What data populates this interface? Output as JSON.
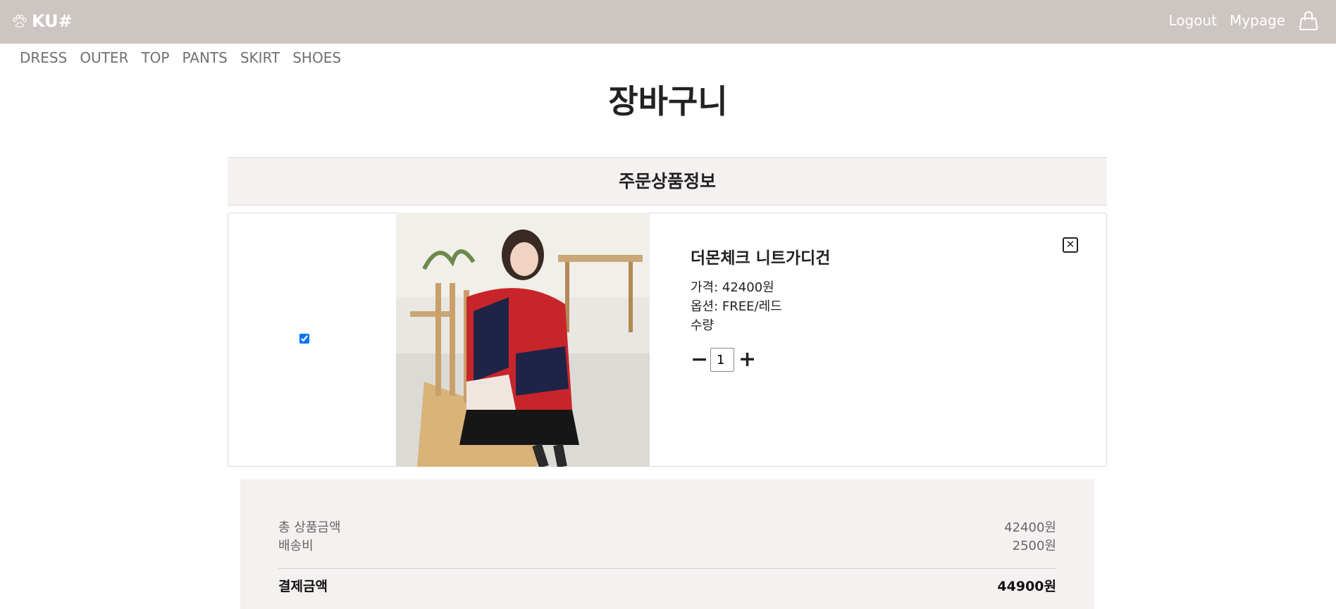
{
  "header": {
    "logo_text": "KU#",
    "logout": "Logout",
    "mypage": "Mypage",
    "background_color": "#cdc5c2"
  },
  "nav": [
    "DRESS",
    "OUTER",
    "TOP",
    "PANTS",
    "SKIRT",
    "SHOES"
  ],
  "page_title": "장바구니",
  "section_title": "주문상품정보",
  "cart_item": {
    "checked": true,
    "name": "더몬체크 니트가디건",
    "price_line": "가격: 42400원",
    "option_line": "옵션: FREE/레드",
    "quantity_label": "수량",
    "quantity": "1",
    "minus": "−",
    "plus": "+",
    "delete": "✕"
  },
  "summary": {
    "subtotal_label": "총 상품금액",
    "subtotal": "42400원",
    "shipping_label": "배송비",
    "shipping": "2500원",
    "total_label": "결제금액",
    "total": "44900원"
  }
}
